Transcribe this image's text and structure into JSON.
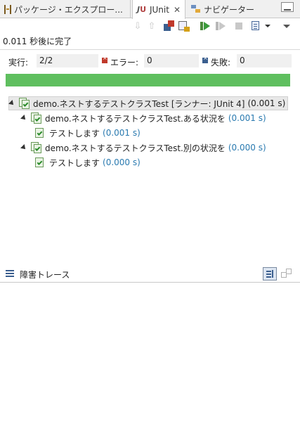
{
  "tabs": [
    {
      "label": "パッケージ・エクスプロー...",
      "icon": "package-explorer-icon"
    },
    {
      "label": "JUnit",
      "icon": "junit-icon",
      "active": true
    },
    {
      "label": "ナビゲーター",
      "icon": "navigator-icon"
    }
  ],
  "status_message": "0.011 秒後に完了",
  "counters": {
    "runs_label": "実行:",
    "runs_value": "2/2",
    "errors_label": "エラー:",
    "errors_value": "0",
    "failures_label": "失敗:",
    "failures_value": "0"
  },
  "progress": {
    "fraction": 1.0,
    "color": "#5fbf5f"
  },
  "tree": {
    "root": {
      "label": "demo.ネストするテストクラスTest [ランナー: JUnit 4]",
      "time": "(0.001 s)"
    },
    "children": [
      {
        "label": "demo.ネストするテストクラスTest.ある状況を",
        "time": "(0.001 s)",
        "tests": [
          {
            "label": "テストします",
            "time": "(0.001 s)"
          }
        ]
      },
      {
        "label": "demo.ネストするテストクラスTest.別の状況を",
        "time": "(0.000 s)",
        "tests": [
          {
            "label": "テストします",
            "time": "(0.000 s)"
          }
        ]
      }
    ]
  },
  "failure_trace": {
    "title": "障害トレース"
  },
  "colors": {
    "success": "#5fbf5f",
    "error": "#c0392b",
    "failure": "#3b5f8f",
    "time": "#2a7ab0"
  }
}
